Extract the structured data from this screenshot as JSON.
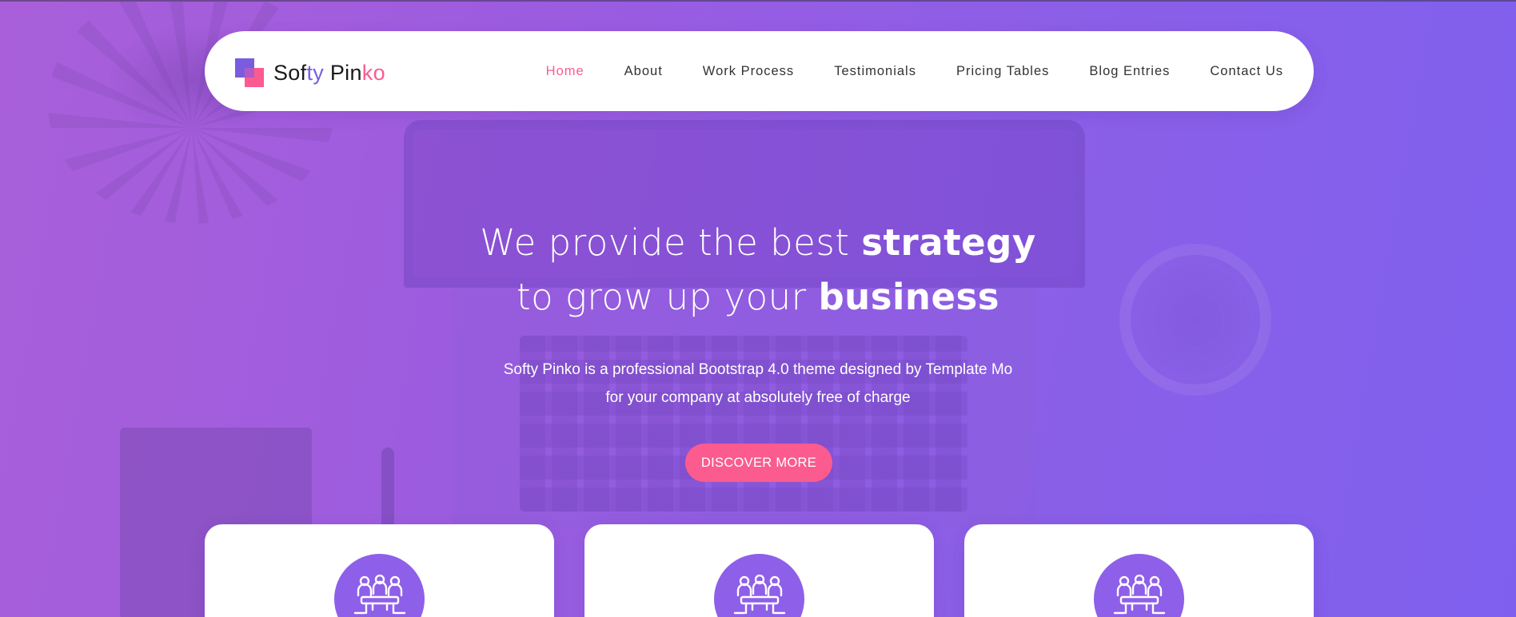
{
  "logo": {
    "part1": "Sof",
    "part2": "ty",
    "part3": " Pin",
    "part4": "ko"
  },
  "nav": {
    "items": [
      "Home",
      "About",
      "Work Process",
      "Testimonials",
      "Pricing Tables",
      "Blog Entries",
      "Contact Us"
    ],
    "active": "Home"
  },
  "hero": {
    "headline_line1_light": "We provide the best ",
    "headline_line1_bold": "strategy",
    "headline_line2_light": "to grow up your ",
    "headline_line2_bold": "business",
    "subtitle_line1": "Softy Pinko is a professional Bootstrap 4.0 theme designed by Template Mo",
    "subtitle_line2": "for your company at absolutely free of charge",
    "cta_label": "DISCOVER MORE"
  },
  "features": [
    {
      "icon": "team-meeting-icon"
    },
    {
      "icon": "team-meeting-icon"
    },
    {
      "icon": "team-meeting-icon"
    }
  ],
  "colors": {
    "accent_pink": "#fb5b8f",
    "accent_purple": "#7a5ce0",
    "hero_gradient_start": "#a95fd9",
    "hero_gradient_end": "#7f60ee",
    "icon_circle": "#8e5fe8"
  }
}
